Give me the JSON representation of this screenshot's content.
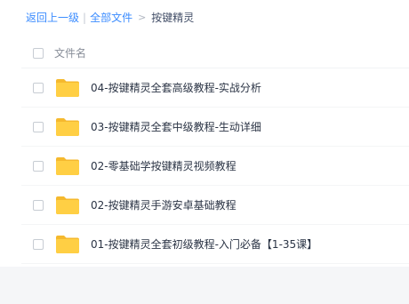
{
  "breadcrumb": {
    "back_label": "返回上一级",
    "separator": "|",
    "all_files_label": "全部文件",
    "arrow": ">",
    "current_label": "按键精灵"
  },
  "list_header": {
    "name_column": "文件名"
  },
  "files": [
    {
      "name": "04-按键精灵全套高级教程-实战分析",
      "icon": "folder-icon"
    },
    {
      "name": "03-按键精灵全套中级教程-生动详细",
      "icon": "folder-icon"
    },
    {
      "name": "02-零基础学按键精灵视频教程",
      "icon": "folder-icon"
    },
    {
      "name": "02-按键精灵手游安卓基础教程",
      "icon": "folder-icon"
    },
    {
      "name": "01-按键精灵全套初级教程-入门必备【1-35课】",
      "icon": "folder-icon"
    }
  ],
  "colors": {
    "link": "#3b8cff",
    "folder": "#ffcf44",
    "folder_tab": "#f5b92e"
  }
}
